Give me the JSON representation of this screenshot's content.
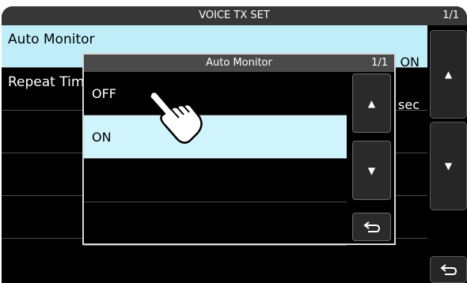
{
  "header": {
    "title": "VOICE TX SET",
    "page": "1/1"
  },
  "menu": {
    "items": [
      {
        "label": "Auto Monitor",
        "value": "ON"
      },
      {
        "label": "Repeat Time",
        "value": "sec"
      },
      {
        "label": "",
        "value": ""
      },
      {
        "label": "",
        "value": ""
      },
      {
        "label": "",
        "value": ""
      }
    ]
  },
  "side_buttons": {
    "up": "up-arrow",
    "down": "down-arrow",
    "back": "return-arrow"
  },
  "dialog": {
    "title": "Auto Monitor",
    "page": "1/1",
    "options": [
      "OFF",
      "ON"
    ],
    "selected": "ON"
  },
  "colors": {
    "selected_row": "#bfeef8",
    "background": "#000000",
    "title_bar": "#373737"
  },
  "icons": {
    "pointer": "pointing-hand-icon"
  }
}
